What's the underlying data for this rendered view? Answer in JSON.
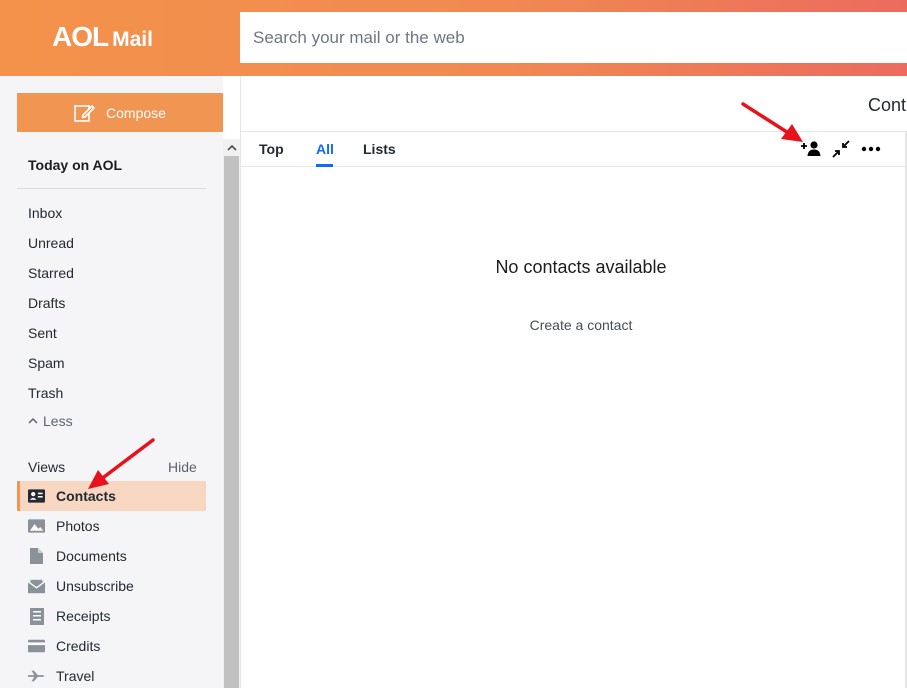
{
  "header": {
    "logo_aol": "AOL",
    "logo_mail": "Mail",
    "search_placeholder": "Search your mail or the web"
  },
  "sidebar": {
    "compose_label": "Compose",
    "today_label": "Today on AOL",
    "folders": [
      "Inbox",
      "Unread",
      "Starred",
      "Drafts",
      "Sent",
      "Spam",
      "Trash"
    ],
    "less_label": "Less",
    "views_label": "Views",
    "hide_label": "Hide",
    "views": [
      {
        "label": "Contacts",
        "icon": "contacts-card-icon",
        "active": true
      },
      {
        "label": "Photos",
        "icon": "photos-icon",
        "active": false
      },
      {
        "label": "Documents",
        "icon": "document-icon",
        "active": false
      },
      {
        "label": "Unsubscribe",
        "icon": "unsubscribe-icon",
        "active": false
      },
      {
        "label": "Receipts",
        "icon": "receipt-icon",
        "active": false
      },
      {
        "label": "Credits",
        "icon": "credit-card-icon",
        "active": false
      },
      {
        "label": "Travel",
        "icon": "airplane-icon",
        "active": false
      }
    ]
  },
  "contacts": {
    "panel_title": "Cont",
    "tabs": [
      {
        "label": "Top",
        "active": false
      },
      {
        "label": "All",
        "active": true
      },
      {
        "label": "Lists",
        "active": false
      }
    ],
    "toolbar_icons": [
      "add-contact-icon",
      "collapse-icon",
      "more-options-icon"
    ],
    "empty_title": "No contacts available",
    "create_link": "Create a contact"
  },
  "colors": {
    "header_start": "#f4924a",
    "header_end": "#ec6b5e",
    "compose_bg": "#f19552",
    "active_view_bg": "#f7d6c2",
    "active_tab": "#0f69ff",
    "annotation_arrow": "#e8121c"
  }
}
